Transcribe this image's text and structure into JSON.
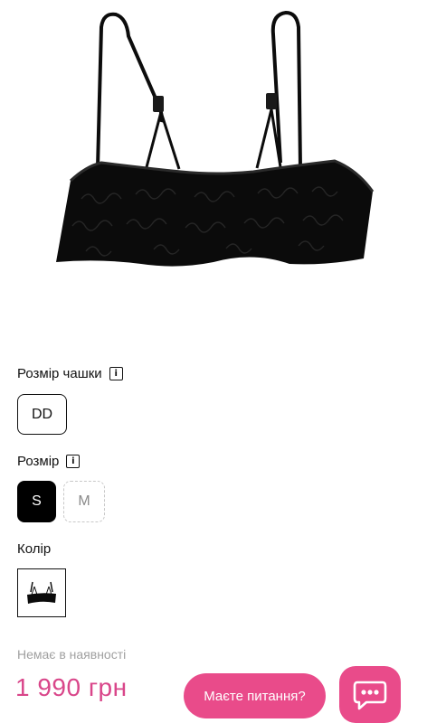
{
  "product": {
    "image_alt_icon": "bra-product-image"
  },
  "cup_size": {
    "label": "Розмір чашки",
    "info_icon": "i",
    "options": [
      "DD"
    ]
  },
  "size": {
    "label": "Розмір",
    "info_icon": "i",
    "options": [
      "S",
      "M"
    ],
    "selected": "S",
    "unavailable": [
      "M"
    ]
  },
  "color": {
    "label": "Колір",
    "swatch_icon": "bra-thumbnail-icon"
  },
  "availability": {
    "status": "Немає в наявності"
  },
  "price": {
    "text": "1 990 грн"
  },
  "chat": {
    "pill_label": "Маєте питання?",
    "icon": "chat-bubble-icon"
  },
  "colors": {
    "accent": "#e94b8a",
    "price": "#d9468a",
    "muted": "#a0a0a0"
  }
}
